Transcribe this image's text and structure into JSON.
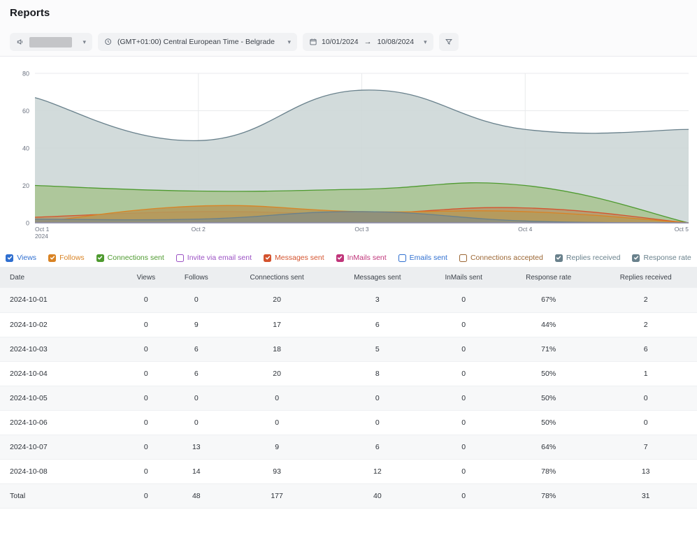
{
  "header": {
    "title": "Reports"
  },
  "toolbar": {
    "campaign": {
      "icon": "megaphone-icon",
      "value": "",
      "redacted": true,
      "chevron": "chevron-down-icon"
    },
    "timezone": {
      "icon": "clock-icon",
      "value": "(GMT+01:00) Central European Time - Belgrade",
      "chevron": "chevron-down-icon"
    },
    "date_range": {
      "icon": "calendar-icon",
      "start": "10/01/2024",
      "arrow": "→",
      "end": "10/08/2024",
      "chevron": "chevron-down-icon"
    },
    "filter": {
      "icon": "filter-icon",
      "label": ""
    }
  },
  "legend": {
    "items": [
      {
        "label": "Views",
        "color": "#2f6fd0",
        "checked": true
      },
      {
        "label": "Follows",
        "color": "#d98324",
        "checked": true
      },
      {
        "label": "Connections sent",
        "color": "#4e9a2f",
        "checked": true
      },
      {
        "label": "Invite via email sent",
        "color": "#9b51c4",
        "checked": false
      },
      {
        "label": "Messages sent",
        "color": "#d4532e",
        "checked": true
      },
      {
        "label": "InMails sent",
        "color": "#c0357a",
        "checked": true
      },
      {
        "label": "Emails sent",
        "color": "#2f6fd0",
        "checked": false
      },
      {
        "label": "Connections accepted",
        "color": "#9b6633",
        "checked": false
      },
      {
        "label": "Replies received",
        "color": "#69818c",
        "checked": true
      },
      {
        "label": "Response rate",
        "color": "#69818c",
        "checked": true
      }
    ]
  },
  "chart_data": {
    "type": "area",
    "title": "",
    "xlabel": "",
    "ylabel": "",
    "ylim": [
      0,
      80
    ],
    "yticks": [
      0,
      20,
      40,
      60,
      80
    ],
    "x_tick_labels": [
      "Oct 1",
      "Oct 2",
      "Oct 3",
      "Oct 4",
      "Oct 5"
    ],
    "x_tick_sublabel": "2024",
    "grid": true,
    "legend_position": "bottom",
    "interpolation": "smooth",
    "x": [
      "2024-10-01",
      "2024-10-02",
      "2024-10-03",
      "2024-10-04",
      "2024-10-05"
    ],
    "series": [
      {
        "name": "Response rate",
        "color": "#69818c",
        "fill": "#ccd6d6",
        "values": [
          67,
          44,
          71,
          50,
          50
        ]
      },
      {
        "name": "Connections sent",
        "color": "#4e9a2f",
        "fill": "#a8c492",
        "values": [
          20,
          17,
          18,
          20,
          0
        ]
      },
      {
        "name": "Messages sent",
        "color": "#d4532e",
        "fill": "#b79a6e",
        "values": [
          3,
          6,
          5,
          8,
          0
        ]
      },
      {
        "name": "Follows",
        "color": "#d98324",
        "fill": "#b59b5b",
        "values": [
          0,
          9,
          6,
          6,
          0
        ]
      },
      {
        "name": "Replies received",
        "color": "#69818c",
        "fill": "#8c8f7f",
        "values": [
          2,
          2,
          6,
          1,
          0
        ]
      },
      {
        "name": "InMails sent",
        "color": "#c0357a",
        "fill": "#a08a84",
        "values": [
          0,
          0,
          0,
          0,
          0
        ]
      },
      {
        "name": "Views",
        "color": "#2f6fd0",
        "fill": "#8d9a9a",
        "values": [
          0,
          0,
          0,
          0,
          0
        ]
      }
    ]
  },
  "table": {
    "columns": [
      "Date",
      "Views",
      "Follows",
      "Connections sent",
      "Messages sent",
      "InMails sent",
      "Response rate",
      "Replies received"
    ],
    "rows": [
      {
        "cells": [
          "2024-10-01",
          "0",
          "0",
          "20",
          "3",
          "0",
          "67%",
          "2"
        ]
      },
      {
        "cells": [
          "2024-10-02",
          "0",
          "9",
          "17",
          "6",
          "0",
          "44%",
          "2"
        ]
      },
      {
        "cells": [
          "2024-10-03",
          "0",
          "6",
          "18",
          "5",
          "0",
          "71%",
          "6"
        ]
      },
      {
        "cells": [
          "2024-10-04",
          "0",
          "6",
          "20",
          "8",
          "0",
          "50%",
          "1"
        ]
      },
      {
        "cells": [
          "2024-10-05",
          "0",
          "0",
          "0",
          "0",
          "0",
          "50%",
          "0"
        ]
      },
      {
        "cells": [
          "2024-10-06",
          "0",
          "0",
          "0",
          "0",
          "0",
          "50%",
          "0"
        ]
      },
      {
        "cells": [
          "2024-10-07",
          "0",
          "13",
          "9",
          "6",
          "0",
          "64%",
          "7"
        ]
      },
      {
        "cells": [
          "2024-10-08",
          "0",
          "14",
          "93",
          "12",
          "0",
          "78%",
          "13"
        ]
      },
      {
        "cells": [
          "Total",
          "0",
          "48",
          "177",
          "40",
          "0",
          "78%",
          "31"
        ],
        "total": true
      }
    ]
  }
}
